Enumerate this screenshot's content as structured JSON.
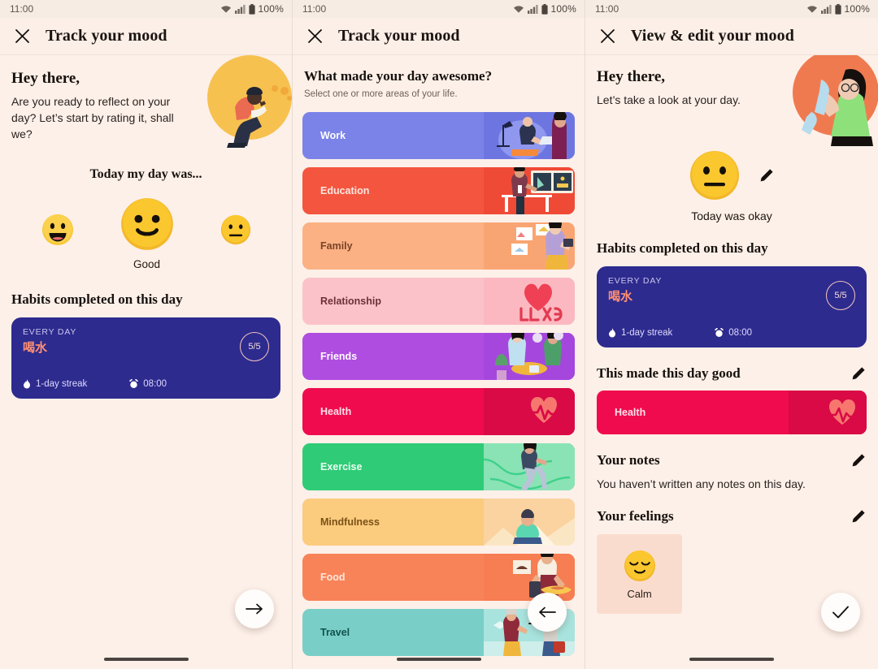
{
  "statusbar": {
    "time": "11:00",
    "battery": "100%",
    "wifi_icon": "wifi-icon",
    "signal_icon": "cellular-signal-icon",
    "battery_icon": "battery-icon"
  },
  "panel1": {
    "appbar": {
      "title": "Track your mood",
      "close_icon": "close-icon"
    },
    "hero": {
      "heading": "Hey there,",
      "body": "Are you ready to reflect on your day? Let’s start by rating it, shall we?",
      "art": "person-kneeling-illustration"
    },
    "mood_question": "Today my day was...",
    "moods": [
      {
        "id": "great",
        "emoji": "grinning-face",
        "label": "",
        "selected": false
      },
      {
        "id": "good",
        "emoji": "slightly-smiling-face",
        "label": "Good",
        "selected": true
      },
      {
        "id": "okay",
        "emoji": "neutral-face",
        "label": "",
        "selected": false
      }
    ],
    "habits_title": "Habits completed on this day",
    "habit": {
      "frequency": "EVERY DAY",
      "name": "喝水",
      "progress": "5/5",
      "streak": "1-day streak",
      "time": "08:00",
      "streak_icon": "flame-icon",
      "time_icon": "alarm-clock-icon",
      "bg": "#2d2b8e",
      "name_color": "#ff8f73"
    },
    "fab": {
      "icon": "arrow-right-icon",
      "name": "next-button"
    }
  },
  "panel2": {
    "appbar": {
      "title": "Track your mood",
      "close_icon": "close-icon"
    },
    "heading": "What made your day awesome?",
    "subheading": "Select one or more areas of your life.",
    "categories": [
      {
        "label": "Work",
        "bg": "#7b83e8",
        "text": "#ffffff",
        "art_bg": "#6d76e0",
        "art": "work-desk-illustration"
      },
      {
        "label": "Education",
        "bg": "#f4553f",
        "text": "#fce7e2",
        "art_bg": "#ef4a36",
        "art": "teacher-board-illustration"
      },
      {
        "label": "Family",
        "bg": "#fbb183",
        "text": "#7a4326",
        "art_bg": "#f9a573",
        "art": "family-photos-illustration"
      },
      {
        "label": "Relationship",
        "bg": "#fbc3c9",
        "text": "#6d3039",
        "art_bg": "#fbb8c0",
        "art": "love-heart-illustration"
      },
      {
        "label": "Friends",
        "bg": "#b martin",
        "text": "#ffffff",
        "art_bg": "#a547dd",
        "art": "friends-table-illustration"
      },
      {
        "label": "Health",
        "bg": "#f00b4e",
        "text": "#ffe2ea",
        "art_bg": "#d90a46",
        "art": "heartbeat-illustration"
      },
      {
        "label": "Exercise",
        "bg": "#2fcb76",
        "text": "#eafff2",
        "art_bg": "#8ae3b4",
        "art": "running-person-illustration"
      },
      {
        "label": "Mindfulness",
        "bg": "#fbcb7e",
        "text": "#7a5216",
        "art_bg": "#fad3a0",
        "art": "meditation-illustration"
      },
      {
        "label": "Food",
        "bg": "#f98359",
        "text": "#ffe7dc",
        "art_bg": "#f77d52",
        "art": "cooking-illustration"
      },
      {
        "label": "Travel",
        "bg": "#79cfc8",
        "text": "#12514d",
        "art_bg": "#a9e3de",
        "art": "travel-people-illustration"
      }
    ],
    "fab": {
      "icon": "arrow-left-icon",
      "name": "back-button"
    }
  },
  "panel3": {
    "appbar": {
      "title": "View & edit your mood",
      "close_icon": "close-icon"
    },
    "hero": {
      "heading": "Hey there,",
      "body": "Let’s take a look at your day.",
      "art": "woman-reading-list-illustration"
    },
    "mood": {
      "emoji": "neutral-face",
      "label": "Today was okay",
      "edit_icon": "pencil-icon"
    },
    "habits_title": "Habits completed on this day",
    "habit": {
      "frequency": "EVERY DAY",
      "name": "喝水",
      "progress": "5/5",
      "streak": "1-day streak",
      "time": "08:00",
      "streak_icon": "flame-icon",
      "time_icon": "alarm-clock-icon",
      "bg": "#2d2b8e",
      "name_color": "#ff8f73"
    },
    "good_title": "This made this day good",
    "good_tag": {
      "label": "Health",
      "bg": "#f00b4e",
      "text": "#ffe2ea",
      "art_bg": "#d90a46",
      "art": "heartbeat-illustration"
    },
    "notes_title": "Your notes",
    "notes_body": "You haven’t written any notes on this day.",
    "feelings_title": "Your feelings",
    "feelings": [
      {
        "label": "Calm",
        "emoji": "relieved-face",
        "bg": "#fadcce"
      }
    ],
    "fab": {
      "icon": "check-icon",
      "name": "confirm-button"
    }
  },
  "theme": {
    "page_bg": "#fdf0e9",
    "appbar_bg": "#fcefe8",
    "statusbar_bg": "#f6ece4",
    "heading_color": "#17110d"
  }
}
